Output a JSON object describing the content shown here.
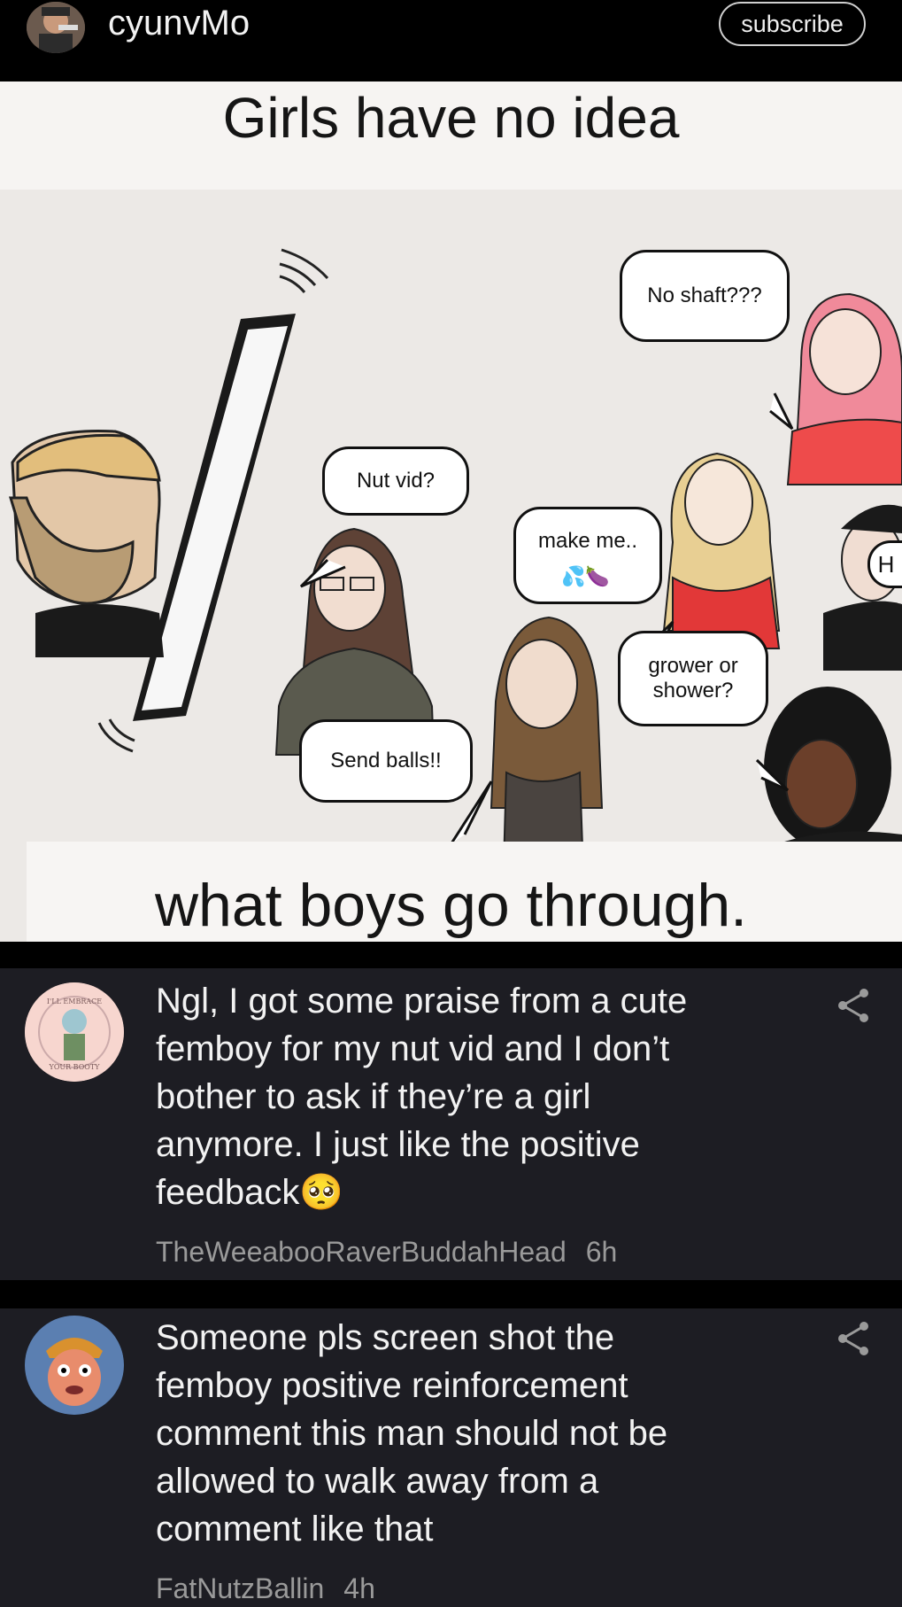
{
  "header": {
    "channel_name": "cyunvMo",
    "subscribe_label": "subscribe"
  },
  "meme": {
    "title": "Girls have no idea",
    "caption": "what boys go through.",
    "bubbles": {
      "no_shaft": "No shaft???",
      "nut_vid": "Nut vid?",
      "make_me": "make me..",
      "grower": "grower or shower?",
      "send_balls": "Send balls!!"
    },
    "edge_letter": "H"
  },
  "comments": [
    {
      "text": "Ngl, I got some praise from a cute femboy for my nut vid and I don’t bother to ask if they’re a girl anymore. I just like the positive feedback🥺",
      "author": "TheWeeabooRaverBuddahHead",
      "time": "6h",
      "avatar_top_text": "I'LL EMBRACE",
      "avatar_bottom_text": "YOUR BOOTY"
    },
    {
      "text": "Someone pls screen shot the femboy positive reinforcement comment this man should not be allowed to walk away from a comment like that",
      "author": "FatNutzBallin",
      "time": "4h"
    }
  ],
  "colors": {
    "comment_bg": "#1d1d23",
    "meta_text": "#9a9a9a"
  }
}
